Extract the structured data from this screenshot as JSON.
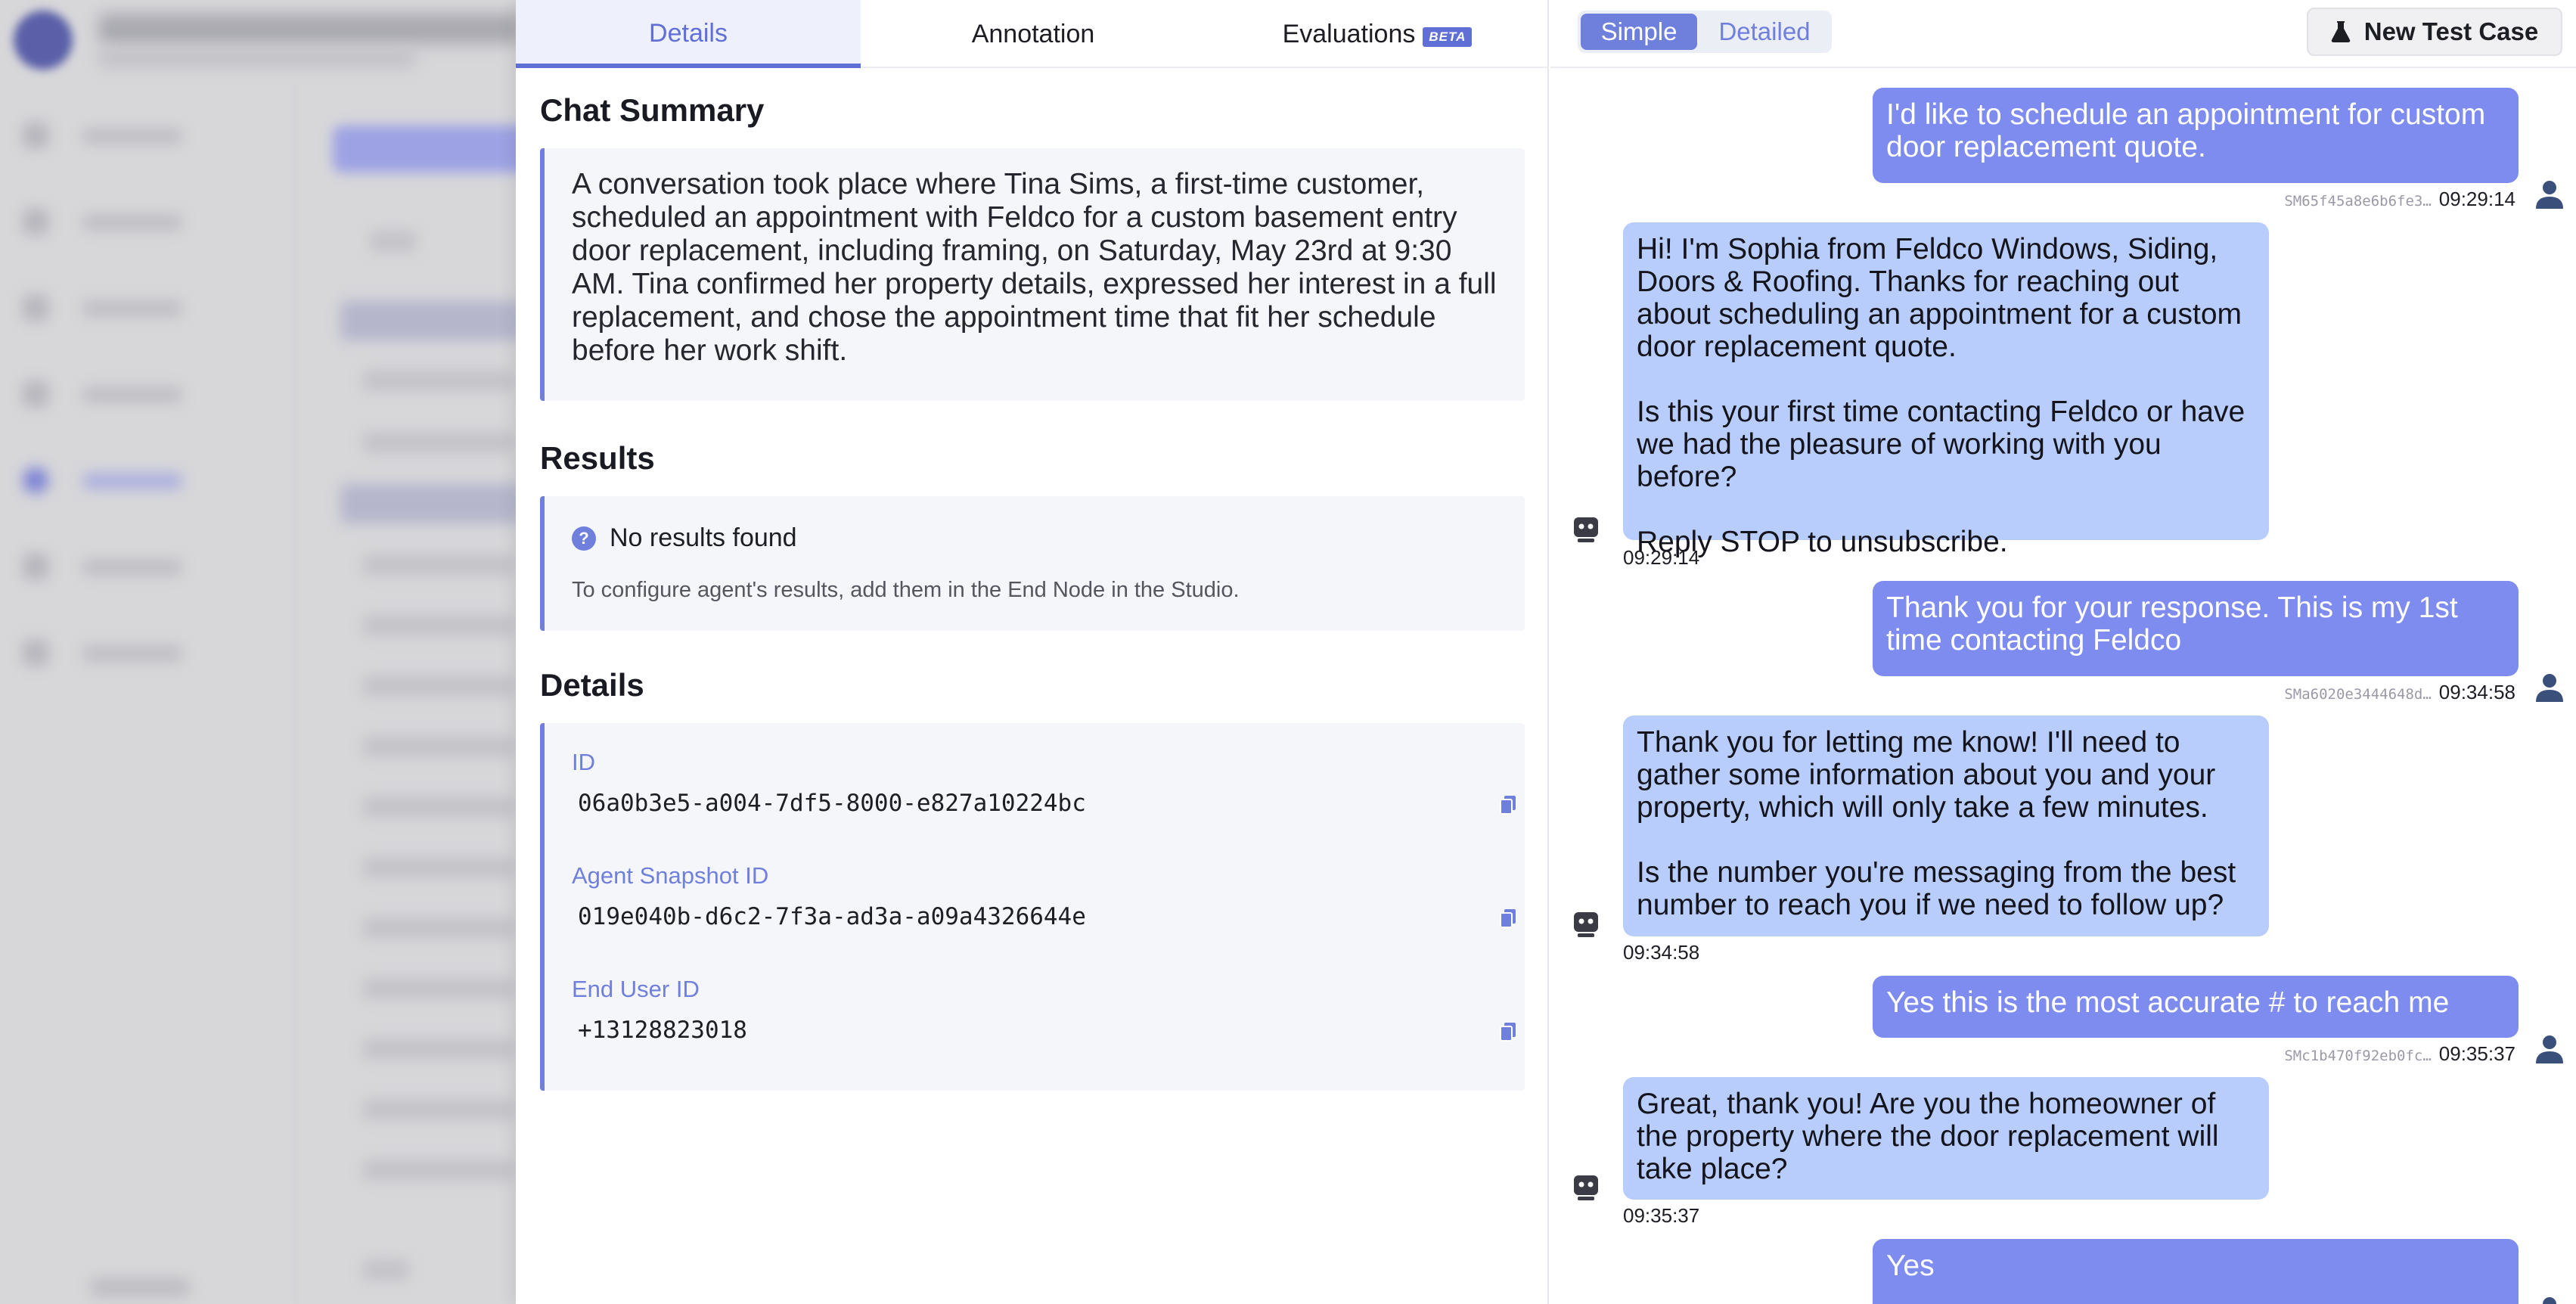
{
  "tabs": [
    {
      "label": "Details"
    },
    {
      "label": "Annotation"
    },
    {
      "label": "Evaluations",
      "badge": "BETA"
    }
  ],
  "chat_summary": {
    "title": "Chat Summary",
    "text": "A conversation took place where Tina Sims, a first-time customer, scheduled an appointment with Feldco for a custom basement entry door replacement, including framing, on Saturday, May 23rd at 9:30 AM. Tina confirmed her property details, expressed her interest in a full replacement, and chose the appointment time that fit her schedule before her work shift."
  },
  "results": {
    "title": "Results",
    "empty_title": "No results found",
    "empty_hint": "To configure agent's results, add them in the End Node in the Studio."
  },
  "details": {
    "title": "Details",
    "fields": [
      {
        "label": "ID",
        "value": "06a0b3e5-a004-7df5-8000-e827a10224bc"
      },
      {
        "label": "Agent Snapshot ID",
        "value": "019e040b-d6c2-7f3a-ad3a-a09a4326644e"
      },
      {
        "label": "End User ID",
        "value": "+13128823018"
      }
    ]
  },
  "conversation": {
    "view_toggle": {
      "simple": "Simple",
      "detailed": "Detailed",
      "selected": "Simple"
    },
    "new_test_case_label": "New Test Case",
    "messages": [
      {
        "role": "user",
        "text": "I'd like to schedule an appointment for custom door replacement quote.",
        "sid": "SM65f45a8e6b6fe3…",
        "time": "09:29:14"
      },
      {
        "role": "bot",
        "text": "Hi! I'm Sophia from Feldco Windows, Siding, Doors & Roofing. Thanks for reaching out about scheduling an appointment for a custom door replacement quote.\n\nIs this your first time contacting Feldco or have we had the pleasure of working with you before?\n\nReply STOP to unsubscribe.",
        "time": "09:29:14"
      },
      {
        "role": "user",
        "text": "Thank you for your response. This is my 1st time contacting Feldco",
        "sid": "SMa6020e3444648d…",
        "time": "09:34:58"
      },
      {
        "role": "bot",
        "text": "Thank you for letting me know! I'll need to gather some information about you and your property, which will only take a few minutes.\n\nIs the number you're messaging from the best number to reach you if we need to follow up?",
        "time": "09:34:58"
      },
      {
        "role": "user",
        "text": "Yes this is the most accurate # to reach me",
        "sid": "SMc1b470f92eb0fc…",
        "time": "09:35:37"
      },
      {
        "role": "bot",
        "text": "Great, thank you! Are you the homeowner of the property where the door replacement will take place?",
        "time": "09:35:37"
      },
      {
        "role": "user",
        "text": "Yes",
        "sid": "",
        "time": ""
      }
    ]
  },
  "colors": {
    "accent": "#6f7fdc",
    "user_bubble": "#7e8cf0",
    "bot_bubble": "#b8cdfb"
  }
}
